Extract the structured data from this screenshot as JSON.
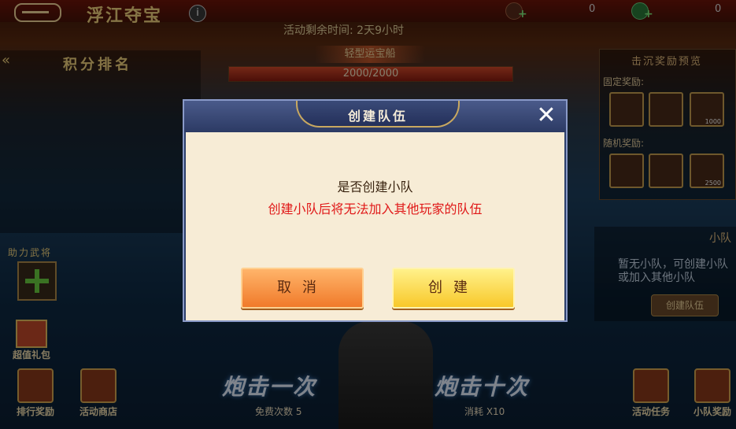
{
  "header": {
    "title": "浮江夺宝",
    "resource1_value": "0",
    "resource2_value": "0",
    "plus": "+"
  },
  "event": {
    "timer": "活动剩余时间:    2天9小时",
    "ship_name": "轻型运宝船",
    "hp_text": "2000/2000",
    "hp_fraction": 1.0
  },
  "left_panel": {
    "rank_title": "积分排名",
    "back_arrow": "«",
    "helper_label": "助力武将",
    "gift_label": "超值礼包"
  },
  "right_panel": {
    "reward_title": "击沉奖励预览",
    "fixed_label": "固定奖励:",
    "random_label": "随机奖励:",
    "fixed_nums": [
      "",
      "",
      "1000"
    ],
    "random_nums": [
      "",
      "",
      "2500"
    ],
    "team_head": "小队",
    "team_msg": "暂无小队，可创建小队或加入其他小队",
    "team_create": "创建队伍"
  },
  "bottom": {
    "rank_reward": "排行奖励",
    "shop": "活动商店",
    "fire_once": "炮击一次",
    "fire_ten": "炮击十次",
    "free_count": "免费次数 5",
    "cost": "消耗   X10",
    "task": "活动任务",
    "team_reward": "小队奖励"
  },
  "modal": {
    "title": "创建队伍",
    "question": "是否创建小队",
    "warning": "创建小队后将无法加入其他玩家的队伍",
    "cancel": "取消",
    "create": "创建",
    "close": "✕"
  },
  "colors": {
    "warning": "#e01818",
    "cancel_button": "#f07a2a",
    "create_button": "#f8c82a",
    "modal_header": "#2c3f6a"
  }
}
